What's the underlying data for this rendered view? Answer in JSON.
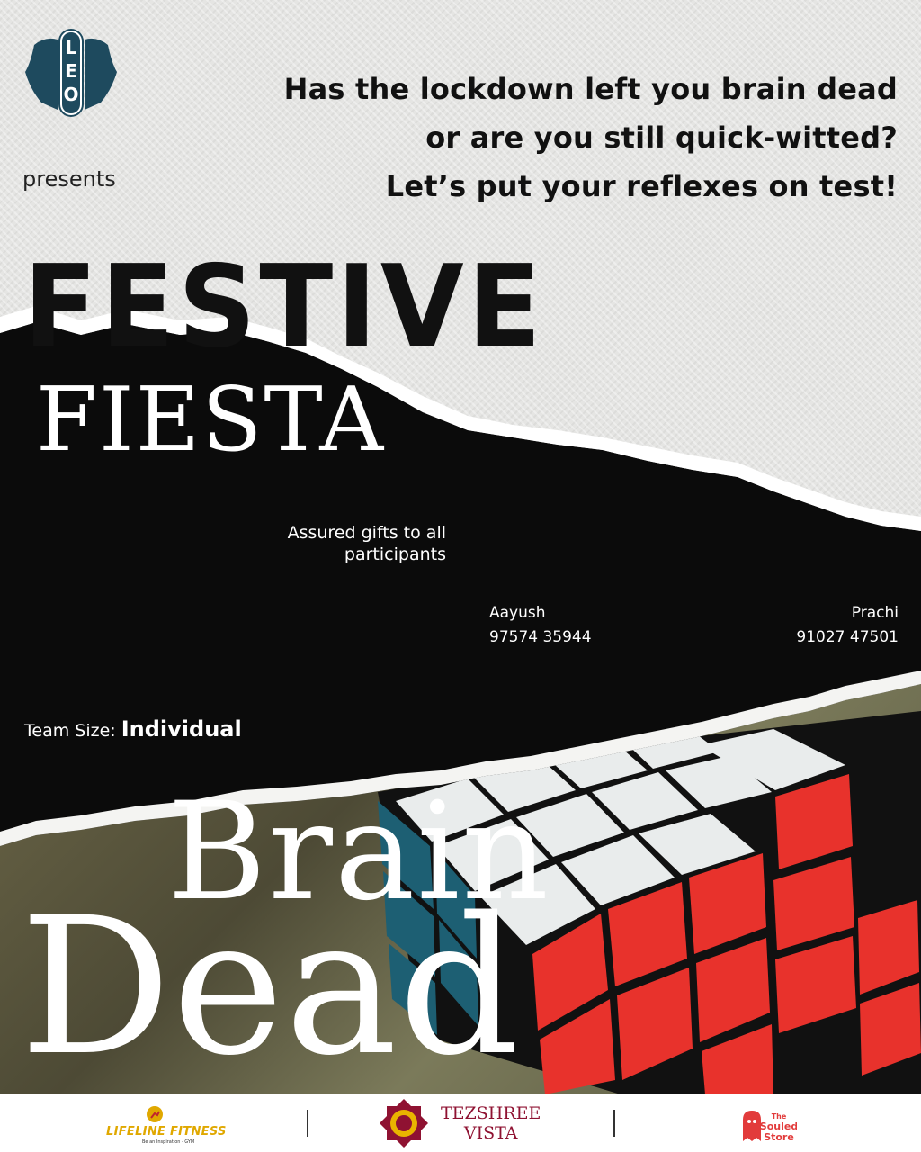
{
  "logo": {
    "text": "LEO",
    "registered": "®"
  },
  "presents": "presents",
  "headline": [
    "Has the lockdown left you brain dead",
    "or are you still quick-witted?",
    "Let’s put your reflexes on test!"
  ],
  "event": {
    "line1": "FESTIVE",
    "line2": "FIESTA"
  },
  "assured": [
    "Assured gifts to all",
    "participants"
  ],
  "contacts": [
    {
      "name": "Aayush",
      "phone": "97574 35944"
    },
    {
      "name": "Prachi",
      "phone": "91027 47501"
    }
  ],
  "team": {
    "label": "Team Size:",
    "value": "Individual"
  },
  "title": {
    "line1": "Brain",
    "line2": "Dead"
  },
  "sponsors": {
    "lifeline": {
      "name": "LIFELINE FITNESS",
      "tagline": "Be an Inspiration · GYM"
    },
    "tezshree": {
      "line1": "TEZSHREE",
      "line2": "VISTA"
    },
    "souled": {
      "line1": "The",
      "line2": "Souled",
      "line3": "Store"
    }
  },
  "colors": {
    "black": "#0b0b0b",
    "paper": "#e5e5e3",
    "cube_red": "#e8322c",
    "cube_white": "#e9ecec",
    "cube_blue": "#1d5f73",
    "tezshree": "#8f1232",
    "lifeline": "#e0a800"
  }
}
